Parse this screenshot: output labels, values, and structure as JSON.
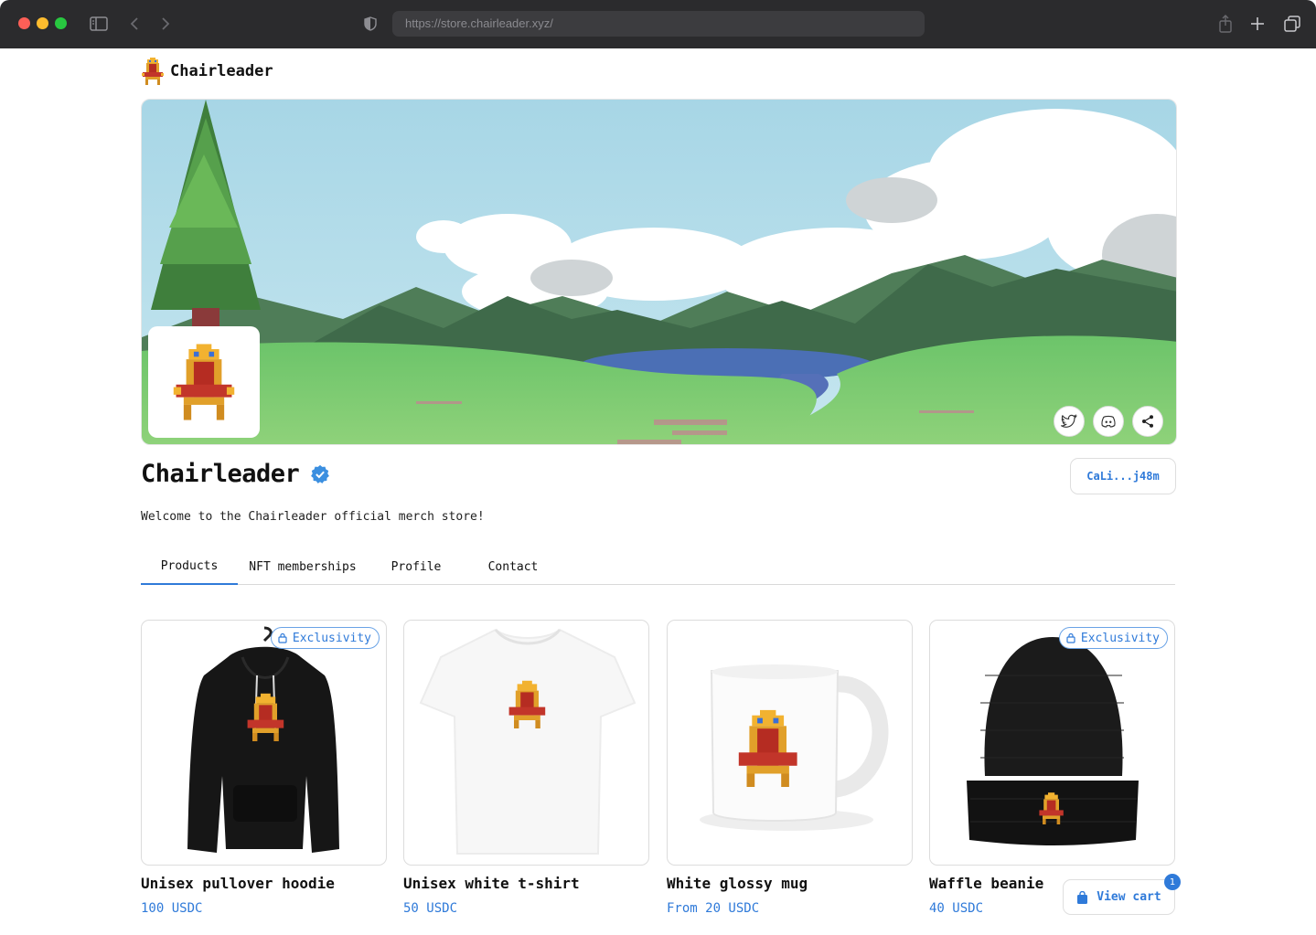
{
  "browser": {
    "url": "https://store.chairleader.xyz/"
  },
  "header": {
    "brand_name": "Chairleader"
  },
  "store": {
    "title": "Chairleader",
    "wallet": "CaLi...j48m",
    "description": "Welcome to the Chairleader official merch store!",
    "social_icons": [
      "twitter-icon",
      "discord-icon",
      "share-icon"
    ]
  },
  "tabs": [
    {
      "label": "Products",
      "active": true
    },
    {
      "label": "NFT memberships",
      "active": false
    },
    {
      "label": "Profile",
      "active": false
    },
    {
      "label": "Contact",
      "active": false
    }
  ],
  "products": [
    {
      "name": "Unisex pullover hoodie",
      "price": "100 USDC",
      "badge": "Exclusivity"
    },
    {
      "name": "Unisex white t-shirt",
      "price": "50 USDC",
      "badge": ""
    },
    {
      "name": "White glossy mug",
      "price": "From 20 USDC",
      "badge": ""
    },
    {
      "name": "Waffle beanie",
      "price": "40 USDC",
      "badge": "Exclusivity"
    }
  ],
  "cart": {
    "label": "View cart",
    "count": "1"
  },
  "colors": {
    "accent": "#2f7ad9",
    "chrome": "#2b2b2d"
  }
}
